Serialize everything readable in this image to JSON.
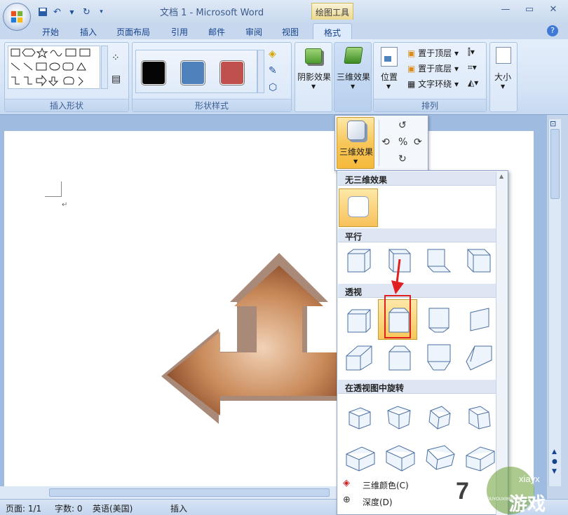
{
  "window": {
    "title": "文档 1 - Microsoft Word",
    "context_group": "绘图工具"
  },
  "tabs": [
    "开始",
    "插入",
    "页面布局",
    "引用",
    "邮件",
    "审阅",
    "视图",
    "格式"
  ],
  "active_tab": "格式",
  "ribbon": {
    "insert_shapes_label": "插入形状",
    "shape_styles_label": "形状样式",
    "shadow_label": "阴影效果",
    "threed_label": "三维效果",
    "position_label": "位置",
    "bring_front_label": "置于顶层",
    "send_back_label": "置于底层",
    "wrap_label": "文字环绕",
    "arrange_label": "排列",
    "size_label": "大小",
    "swatch_colors": [
      "#050505",
      "#4f81bd",
      "#c0504d"
    ]
  },
  "threed_button": {
    "label": "三维效果"
  },
  "gallery": {
    "sections": {
      "none": "无三维效果",
      "parallel": "平行",
      "perspective": "透视",
      "rotate": "在透视图中旋转"
    },
    "menu": [
      {
        "label": "三维颜色(C)",
        "icon": "paint-bucket-icon"
      },
      {
        "label": "深度(D)",
        "icon": "depth-icon"
      }
    ],
    "selected": "perspective-2"
  },
  "status": {
    "page": "页面: 1/1",
    "words": "字数: 0",
    "language": "英语(美国)",
    "mode": "插入"
  },
  "watermark": {
    "text": "xiayx",
    "brand": "游戏",
    "sub": "ZHOUYOUXIWANG",
    "num": "7"
  },
  "accent_color": "#f8c75a",
  "arrow_color": "#b9704a"
}
